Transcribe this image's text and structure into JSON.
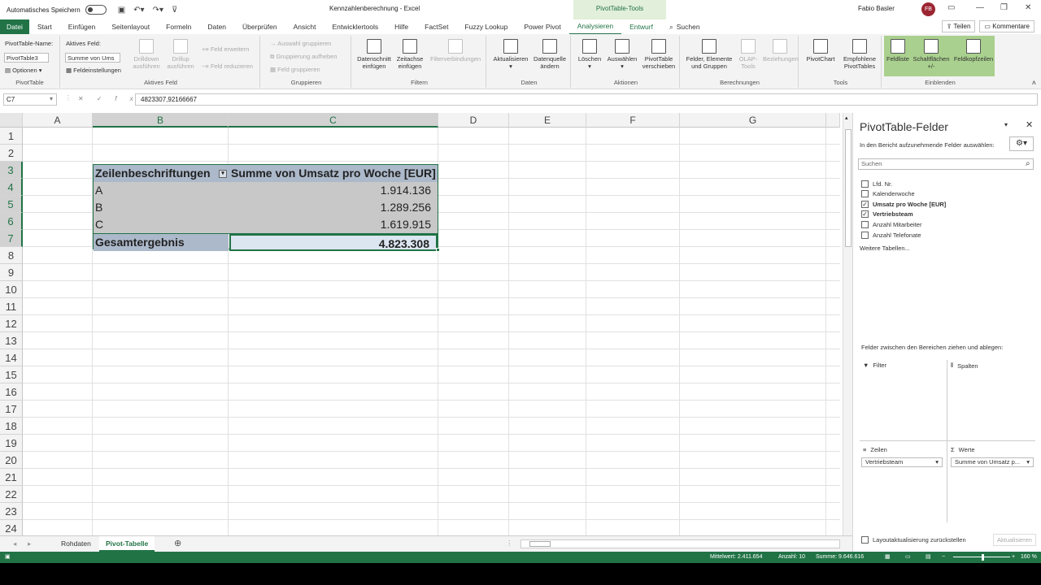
{
  "titlebar": {
    "autosave": "Automatisches Speichern",
    "doc_title": "Kennzahlenberechnung  -  Excel",
    "tools_tab": "PivotTable-Tools",
    "user": "Fabio Basler",
    "initials": "FB"
  },
  "tabs": [
    "Datei",
    "Start",
    "Einfügen",
    "Seitenlayout",
    "Formeln",
    "Daten",
    "Überprüfen",
    "Ansicht",
    "Entwicklertools",
    "Hilfe",
    "FactSet",
    "Fuzzy Lookup",
    "Power Pivot",
    "Analysieren",
    "Entwurf"
  ],
  "search_tab": "Suchen",
  "share": {
    "teilen": "Teilen",
    "kommentare": "Kommentare"
  },
  "ribbon": {
    "pt_name_label": "PivotTable-Name:",
    "pt_name": "PivotTable3",
    "optionen": "Optionen",
    "g_pivottable": "PivotTable",
    "aktives_feld_label": "Aktives Feld:",
    "aktives_feld": "Summe von Ums",
    "feldeinstellungen": "Feldeinstellungen",
    "drilldown": "Drilldown ausführen",
    "drillup": "Drillup ausführen",
    "feld_erweitern": "Feld erweitern",
    "feld_reduzieren": "Feld reduzieren",
    "g_aktives_feld": "Aktives Feld",
    "auswahl_gruppieren": "Auswahl gruppieren",
    "gruppierung_aufheben": "Gruppierung aufheben",
    "feld_gruppieren": "Feld gruppieren",
    "g_gruppieren": "Gruppieren",
    "datenschnitt": "Datenschnitt einfügen",
    "zeitachse": "Zeitachse einfügen",
    "filterverbindungen": "Filterverbindungen",
    "g_filtern": "Filtern",
    "aktualisieren": "Aktualisieren",
    "datenquelle": "Datenquelle ändern",
    "g_daten": "Daten",
    "loeschen": "Löschen",
    "auswaehlen": "Auswählen",
    "verschieben": "PivotTable verschieben",
    "g_aktionen": "Aktionen",
    "felder": "Felder, Elemente und Gruppen",
    "olap": "OLAP-Tools",
    "beziehungen": "Beziehungen",
    "g_berechnungen": "Berechnungen",
    "pivotchart": "PivotChart",
    "empfohlene": "Empfohlene PivotTables",
    "g_tools": "Tools",
    "feldliste": "Feldliste",
    "schaltflaechen": "Schaltflächen +/-",
    "feldkopfzeilen": "Feldkopfzeilen",
    "g_einblenden": "Einblenden"
  },
  "formula_bar": {
    "cell_ref": "C7",
    "formula": "4823307,92166667"
  },
  "columns": [
    "A",
    "B",
    "C",
    "D",
    "E",
    "F",
    "G"
  ],
  "rows": [
    "1",
    "2",
    "3",
    "4",
    "5",
    "6",
    "7",
    "8",
    "9",
    "10",
    "11",
    "12",
    "13",
    "14",
    "15",
    "16",
    "17",
    "18",
    "19",
    "20",
    "21",
    "22",
    "23",
    "24"
  ],
  "pivot": {
    "header_label": "Zeilenbeschriftungen",
    "header_value": "Summe von Umsatz pro Woche [EUR]",
    "rows": [
      {
        "label": "A",
        "value": "1.914.136"
      },
      {
        "label": "B",
        "value": "1.289.256"
      },
      {
        "label": "C",
        "value": "1.619.915"
      }
    ],
    "total_label": "Gesamtergebnis",
    "total_value": "4.823.308"
  },
  "sheets": {
    "tab1": "Rohdaten",
    "tab2": "Pivot-Tabelle"
  },
  "status": {
    "mittelwert": "Mittelwert: 2.411.654",
    "anzahl": "Anzahl: 10",
    "summe": "Summe: 9.646.616",
    "zoom": "160 %"
  },
  "pane": {
    "title": "PivotTable-Felder",
    "subtitle": "In den Bericht aufzunehmende Felder auswählen:",
    "search": "Suchen",
    "fields": [
      {
        "label": "Lfd. Nr.",
        "checked": false
      },
      {
        "label": "Kalenderwoche",
        "checked": false
      },
      {
        "label": "Umsatz pro Woche [EUR]",
        "checked": true
      },
      {
        "label": "Vertriebsteam",
        "checked": true
      },
      {
        "label": "Anzahl Mitarbeiter",
        "checked": false
      },
      {
        "label": "Anzahl Telefonate",
        "checked": false
      }
    ],
    "weitere": "Weitere Tabellen...",
    "drag_hint": "Felder zwischen den Bereichen ziehen und ablegen:",
    "filter": "Filter",
    "spalten": "Spalten",
    "zeilen": "Zeilen",
    "werte": "Werte",
    "zeilen_item": "Vertriebsteam",
    "werte_item": "Summe von Umsatz p...",
    "layout": "Layoutaktualisierung zurückstellen",
    "aktualisieren": "Aktualisieren"
  }
}
